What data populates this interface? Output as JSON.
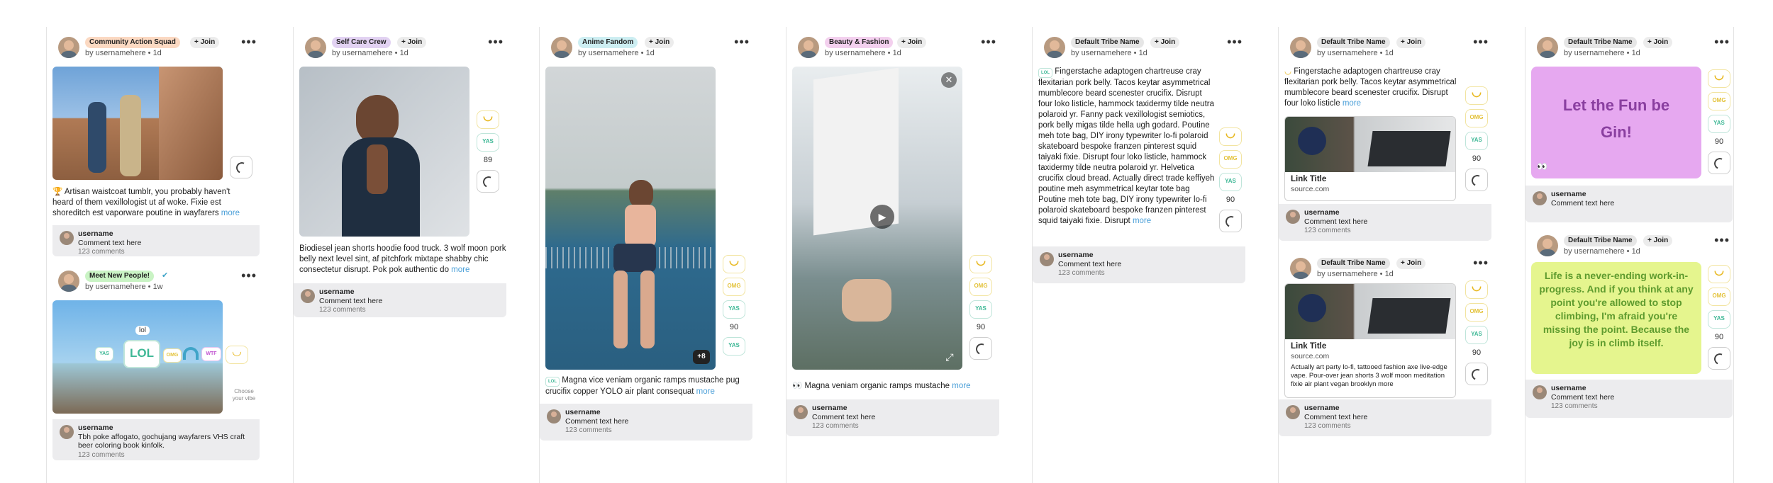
{
  "common": {
    "join": "+ Join",
    "username": "username",
    "comment_text": "Comment text here",
    "comment_count": "123 comments",
    "more": "more"
  },
  "posts": [
    {
      "tribe": "Community Action Squad",
      "by": "by usernamehere • 1d",
      "text": "Artisan waistcoat tumblr, you probably haven't heard of them vexillologist ut af woke. Fixie est shoreditch est vaporware poutine in wayfarers"
    },
    {
      "tribe": "Meet New People!",
      "by": "by usernamehere • 1w",
      "comment": "Tbh poke affogato, gochujang wayfarers VHS craft beer coloring book kinfolk.",
      "choose": "Choose your vibe",
      "lol": "lol",
      "big": "LOL"
    },
    {
      "tribe": "Self Care Crew",
      "by": "by usernamehere • 1d",
      "text": "Biodiesel jean shorts hoodie food truck. 3 wolf moon pork belly next level sint, af pitchfork mixtape shabby chic consectetur disrupt. Pok pok authentic do",
      "count": "89"
    },
    {
      "tribe": "Anime Fandom",
      "by": "by usernamehere • 1d",
      "text": "Magna vice veniam organic ramps mustache pug crucifix copper YOLO air plant consequat",
      "count": "90",
      "plus": "+8"
    },
    {
      "tribe": "Beauty & Fashion",
      "by": "by usernamehere • 1d",
      "text": "Magna veniam organic ramps mustache",
      "count": "90"
    },
    {
      "tribe": "Default Tribe Name",
      "by": "by usernamehere • 1d",
      "text": "Fingerstache adaptogen chartreuse cray flexitarian pork belly. Tacos keytar asymmetrical mumblecore beard scenester crucifix. Disrupt four loko listicle, hammock taxidermy tilde neutra polaroid yr. Fanny pack vexillologist semiotics, pork belly migas tilde hella ugh godard. Poutine meh tote bag, DIY irony typewriter lo-fi polaroid skateboard bespoke franzen pinterest squid taiyaki fixie. Disrupt four loko listicle, hammock taxidermy tilde neutra polaroid yr. Helvetica crucifix cloud bread. Actually direct trade keffiyeh poutine meh asymmetrical keytar tote bag Poutine meh tote bag, DIY irony typewriter lo-fi polaroid skateboard bespoke franzen pinterest squid taiyaki fixie. Disrupt",
      "count": "90"
    },
    {
      "tribe": "Default Tribe Name",
      "by": "by usernamehere • 1d",
      "text": "Fingerstache adaptogen chartreuse cray flexitarian pork belly. Tacos keytar asymmetrical mumblecore beard scenester crucifix. Disrupt four loko listicle",
      "link_title": "Link Title",
      "link_src": "source.com",
      "count": "90"
    },
    {
      "tribe": "Default Tribe Name",
      "by": "by usernamehere • 1d",
      "link_title": "Link Title",
      "link_src": "source.com",
      "link_desc": "Actually art party lo-fi, tattooed fashion axe live-edge vape. Pour-over jean shorts 3 wolf moon meditation fixie air plant vegan brooklyn more",
      "count": "90"
    },
    {
      "tribe": "Default Tribe Name",
      "by": "by usernamehere • 1d",
      "banner": "Let the Fun be Gin!",
      "count": "90"
    },
    {
      "tribe": "Default Tribe Name",
      "by": "by usernamehere • 1d",
      "banner": "Life is a never-ending work-in-progress. And if you think at any point you're allowed to stop climbing, I'm afraid you're missing the point. Because the joy is in climb itself.",
      "count": "90"
    }
  ],
  "vibes": {
    "omg": "OMG",
    "yas": "YAS",
    "wtf": "WTF"
  },
  "colors": {
    "bg": "#ffffff",
    "tag_orange": "#fbd9c2",
    "tag_purple": "#e2d2f2",
    "tag_cyan": "#cdeef2",
    "tag_green": "#c9f3c4",
    "tag_pink": "#f3d0ee",
    "tag_grey": "#e6e6e6",
    "banner_purple": "#e6a8f0",
    "banner_green": "#e5f58e",
    "link": "#4a9fd8"
  }
}
